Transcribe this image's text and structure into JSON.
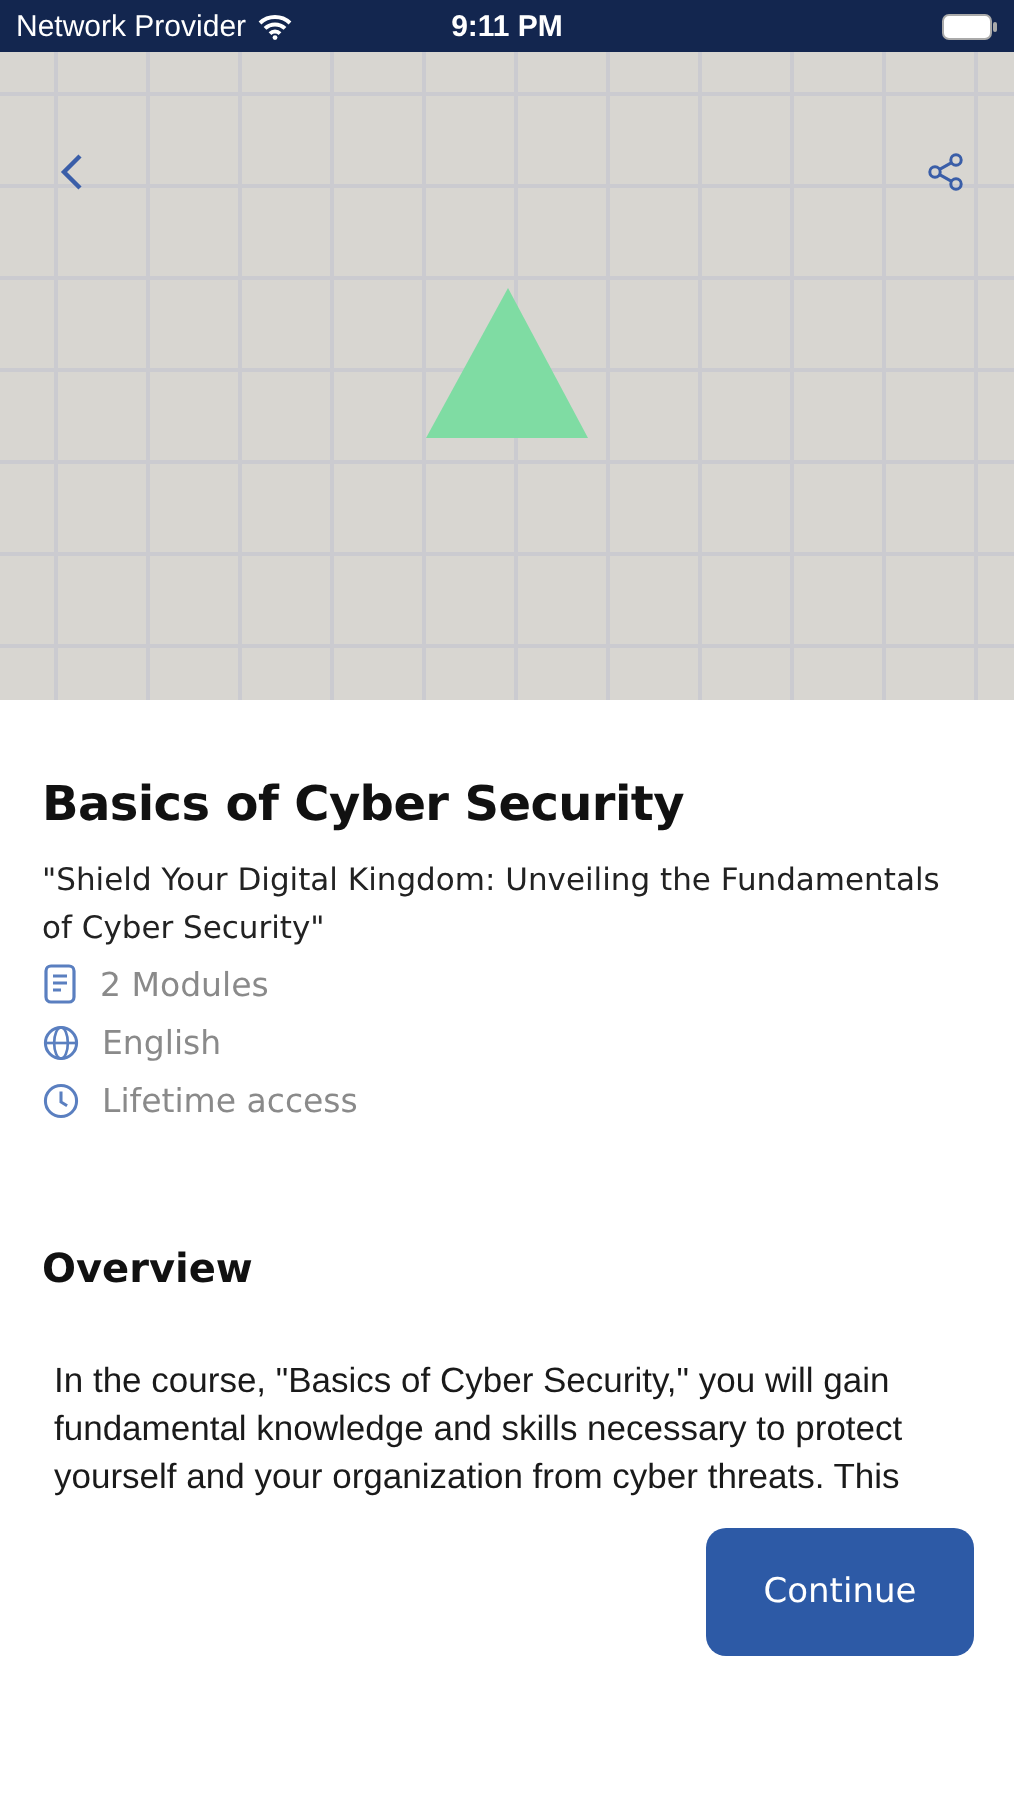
{
  "status_bar": {
    "carrier": "Network Provider",
    "time": "9:11 PM"
  },
  "course": {
    "title": "Basics of Cyber Security",
    "tagline": "\"Shield Your Digital Kingdom: Unveiling the Fundamentals of Cyber Security\"",
    "details": [
      {
        "kind": "document",
        "text": "2 Modules"
      },
      {
        "kind": "globe",
        "text": "English"
      },
      {
        "kind": "clock",
        "text": "Lifetime access"
      }
    ]
  },
  "overview": {
    "heading": "Overview",
    "text": "In the course, \"Basics of Cyber Security,\" you will gain fundamental knowledge and skills necessary to protect yourself and your organization from cyber threats. This"
  },
  "continue_button": {
    "label": "Continue"
  }
}
